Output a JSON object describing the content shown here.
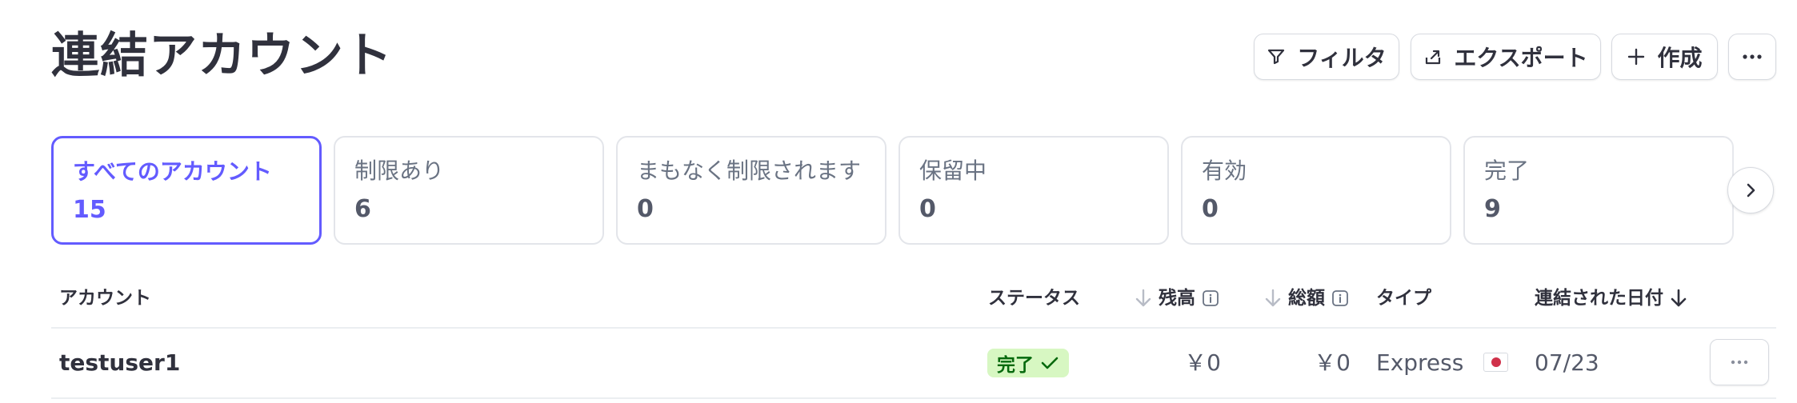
{
  "header": {
    "title": "連結アカウント",
    "actions": {
      "filter_label": "フィルタ",
      "export_label": "エクスポート",
      "create_label": "作成",
      "more_icon": "ellipsis-icon"
    }
  },
  "summary_cards": [
    {
      "label": "すべてのアカウント",
      "count": "15",
      "selected": true
    },
    {
      "label": "制限あり",
      "count": "6",
      "selected": false
    },
    {
      "label": "まもなく制限されます",
      "count": "0",
      "selected": false
    },
    {
      "label": "保留中",
      "count": "0",
      "selected": false
    },
    {
      "label": "有効",
      "count": "0",
      "selected": false
    },
    {
      "label": "完了",
      "count": "9",
      "selected": false
    }
  ],
  "table": {
    "columns": {
      "account": "アカウント",
      "status": "ステータス",
      "balance": "残高",
      "volume": "総額",
      "type": "タイプ",
      "connected_date": "連結された日付"
    },
    "rows": [
      {
        "account": "testuser1",
        "status": "完了",
        "balance": "￥0",
        "volume": "￥0",
        "type": "Express",
        "country_flag": "japan-flag-icon",
        "connected_date": "07/23"
      }
    ]
  },
  "colors": {
    "accent": "#635bff",
    "status_complete_bg": "#d7f7c2",
    "status_complete_text": "#05690d",
    "text_primary": "#30313d",
    "text_secondary": "#6a7383"
  }
}
